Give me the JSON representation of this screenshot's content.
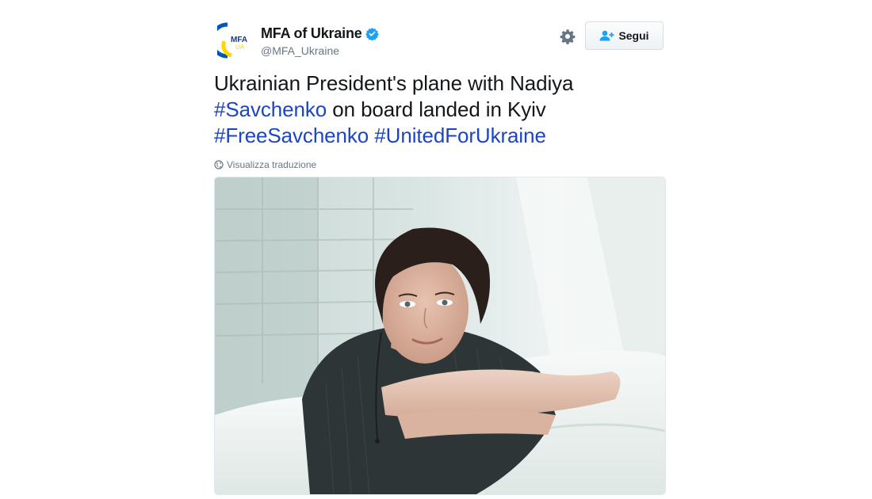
{
  "account": {
    "display_name": "MFA of Ukraine",
    "handle": "@MFA_Ukraine",
    "avatar_text_top": "MFA",
    "avatar_text_bottom": "UA"
  },
  "actions": {
    "follow_label": "Segui",
    "settings_icon": "gear-icon",
    "follow_icon": "add-user-icon"
  },
  "tweet": {
    "text_part1": "Ukrainian President's plane with Nadiya\n",
    "hashtag1": "#Savchenko",
    "text_part2": " on board landed in Kyiv\n",
    "hashtag2": "#FreeSavchenko",
    "text_part3": " ",
    "hashtag3": "#UnitedForUkraine"
  },
  "translate_label": "Visualizza traduzione",
  "colors": {
    "hashtag": "#1b45c4",
    "verified": "#1da1f2",
    "text": "#14171a",
    "secondary": "#657786",
    "ukraine_blue": "#0057b7",
    "ukraine_yellow": "#ffd700"
  }
}
